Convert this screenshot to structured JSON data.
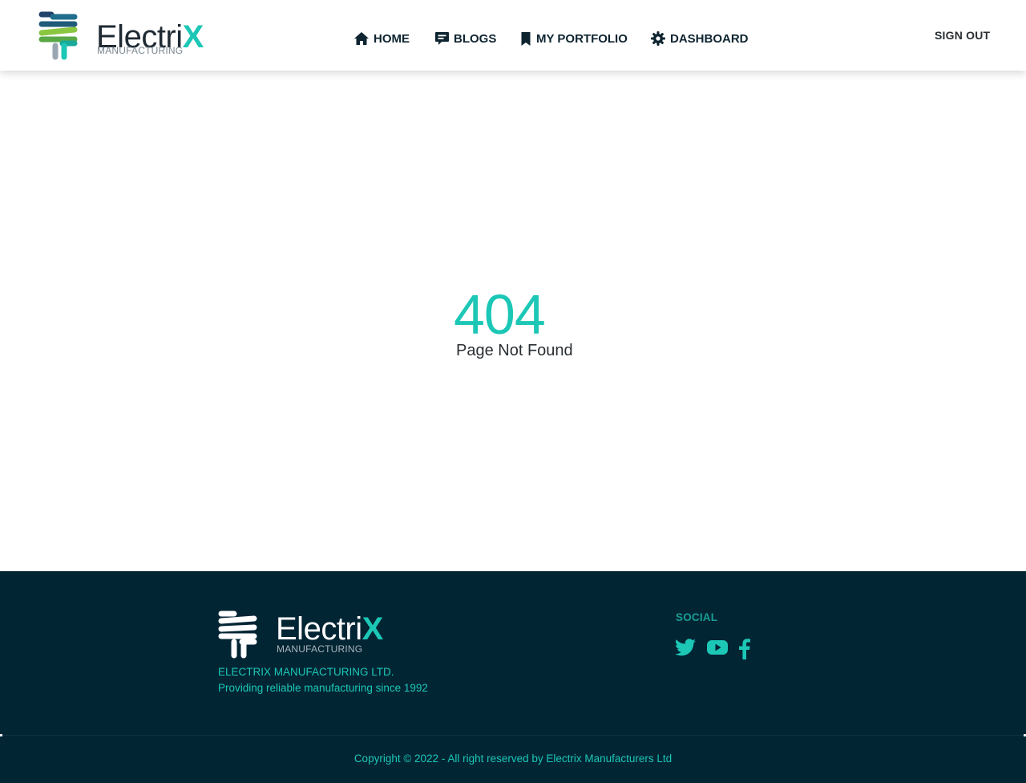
{
  "header": {
    "brand": {
      "name": "Electri",
      "name_accent": "X",
      "sub": "MANUFACTURING"
    },
    "nav": [
      {
        "label": "HOME",
        "icon": "home-icon"
      },
      {
        "label": "BLOGS",
        "icon": "comment-icon"
      },
      {
        "label": "MY PORTFOLIO",
        "icon": "bookmark-icon"
      },
      {
        "label": "DASHBOARD",
        "icon": "gear-icon"
      }
    ],
    "sign_out": "SIGN OUT"
  },
  "main": {
    "error_code": "404",
    "error_message": "Page Not Found"
  },
  "footer": {
    "brand": {
      "name": "Electri",
      "name_accent": "X",
      "sub": "MANUFACTURING"
    },
    "company": "ELECTRIX MANUFACTURING LTD.",
    "tagline": "Providing reliable manufacturing since 1992",
    "social_title": "SOCIAL",
    "social": [
      "twitter-icon",
      "youtube-icon",
      "facebook-icon"
    ],
    "copyright": "Copyright © 2022 - All right reserved by Electrix Manufacturers Ltd"
  },
  "colors": {
    "accent": "#1cc7b6",
    "footer_bg": "#022534",
    "nav_text": "#0e2430"
  }
}
